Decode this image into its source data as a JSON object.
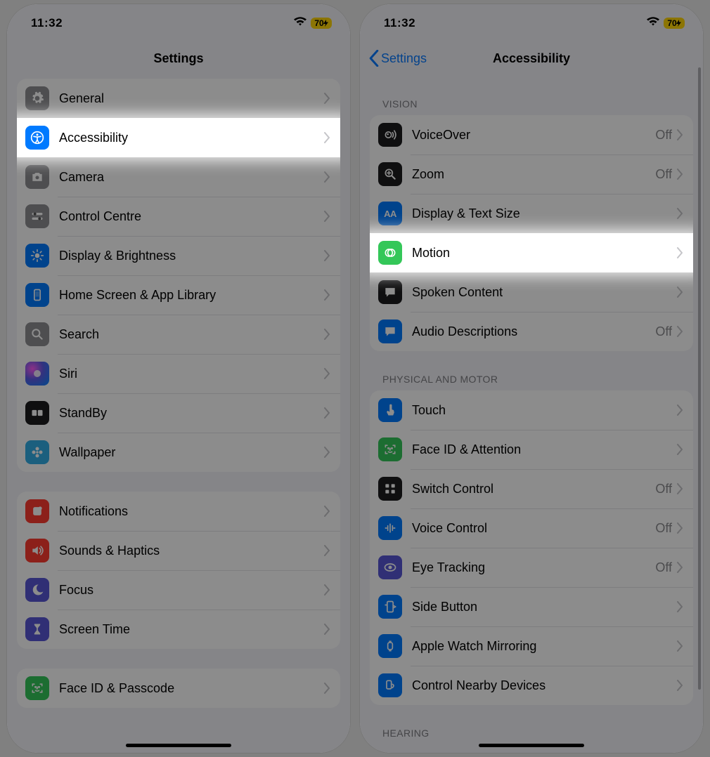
{
  "status": {
    "time": "11:32",
    "battery": "70"
  },
  "left": {
    "title": "Settings",
    "g1": [
      {
        "label": "General",
        "icon": "gear",
        "cls": "c-grey"
      },
      {
        "label": "Accessibility",
        "icon": "access",
        "cls": "c-blue",
        "hl": true
      },
      {
        "label": "Camera",
        "icon": "camera",
        "cls": "c-grey"
      },
      {
        "label": "Control Centre",
        "icon": "sliders",
        "cls": "c-grey"
      },
      {
        "label": "Display & Brightness",
        "icon": "sun",
        "cls": "c-blue"
      },
      {
        "label": "Home Screen & App Library",
        "icon": "phone",
        "cls": "c-blue"
      },
      {
        "label": "Search",
        "icon": "search",
        "cls": "c-grey"
      },
      {
        "label": "Siri",
        "icon": "siri",
        "cls": "c-siri"
      },
      {
        "label": "StandBy",
        "icon": "standby",
        "cls": "c-black"
      },
      {
        "label": "Wallpaper",
        "icon": "flower",
        "cls": "c-cyan"
      }
    ],
    "g2": [
      {
        "label": "Notifications",
        "icon": "bell",
        "cls": "c-red"
      },
      {
        "label": "Sounds & Haptics",
        "icon": "speaker",
        "cls": "c-red"
      },
      {
        "label": "Focus",
        "icon": "moon",
        "cls": "c-purple"
      },
      {
        "label": "Screen Time",
        "icon": "hourglass",
        "cls": "c-purple"
      }
    ],
    "g3": [
      {
        "label": "Face ID & Passcode",
        "icon": "faceid",
        "cls": "c-green"
      }
    ]
  },
  "right": {
    "back": "Settings",
    "title": "Accessibility",
    "sect1": "VISION",
    "vision": [
      {
        "label": "VoiceOver",
        "icon": "voiceover",
        "cls": "c-black",
        "value": "Off"
      },
      {
        "label": "Zoom",
        "icon": "zoom",
        "cls": "c-black",
        "value": "Off"
      },
      {
        "label": "Display & Text Size",
        "icon": "aa",
        "cls": "c-blue"
      },
      {
        "label": "Motion",
        "icon": "motion",
        "cls": "c-green",
        "hl": true
      },
      {
        "label": "Spoken Content",
        "icon": "bubble",
        "cls": "c-black"
      },
      {
        "label": "Audio Descriptions",
        "icon": "bubble",
        "cls": "c-blue",
        "value": "Off"
      }
    ],
    "sect2": "PHYSICAL AND MOTOR",
    "motor": [
      {
        "label": "Touch",
        "icon": "touch",
        "cls": "c-blue"
      },
      {
        "label": "Face ID & Attention",
        "icon": "faceid",
        "cls": "c-green"
      },
      {
        "label": "Switch Control",
        "icon": "grid",
        "cls": "c-black",
        "value": "Off"
      },
      {
        "label": "Voice Control",
        "icon": "voice",
        "cls": "c-blue",
        "value": "Off"
      },
      {
        "label": "Eye Tracking",
        "icon": "eye",
        "cls": "c-purple",
        "value": "Off"
      },
      {
        "label": "Side Button",
        "icon": "side",
        "cls": "c-blue"
      },
      {
        "label": "Apple Watch Mirroring",
        "icon": "watch",
        "cls": "c-blue"
      },
      {
        "label": "Control Nearby Devices",
        "icon": "nearby",
        "cls": "c-blue"
      }
    ],
    "sect3": "HEARING"
  }
}
